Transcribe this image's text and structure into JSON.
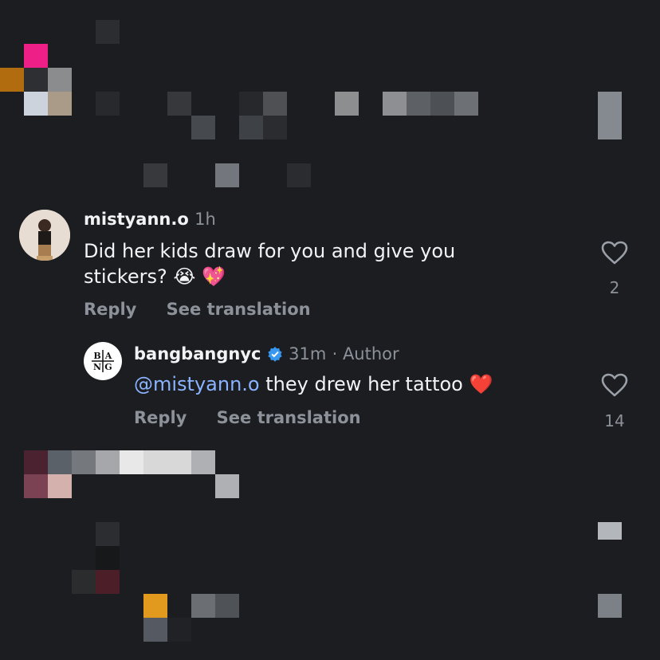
{
  "comments": [
    {
      "username": "mistyann.o",
      "time": "1h",
      "text_line1": "Did her kids draw for you and give you",
      "text_line2": "stickers?",
      "emoji": "😭 💖",
      "reply_label": "Reply",
      "translate_label": "See translation",
      "like_count": "2"
    }
  ],
  "reply": {
    "username": "bangbangnyc",
    "time": "31m",
    "author_label": "· Author",
    "avatar_letters": [
      "B",
      "A",
      "N",
      "G"
    ],
    "mention": "@mistyann.o",
    "text": "they drew her tattoo",
    "emoji": "❤️",
    "reply_label": "Reply",
    "translate_label": "See translation",
    "like_count": "14"
  }
}
